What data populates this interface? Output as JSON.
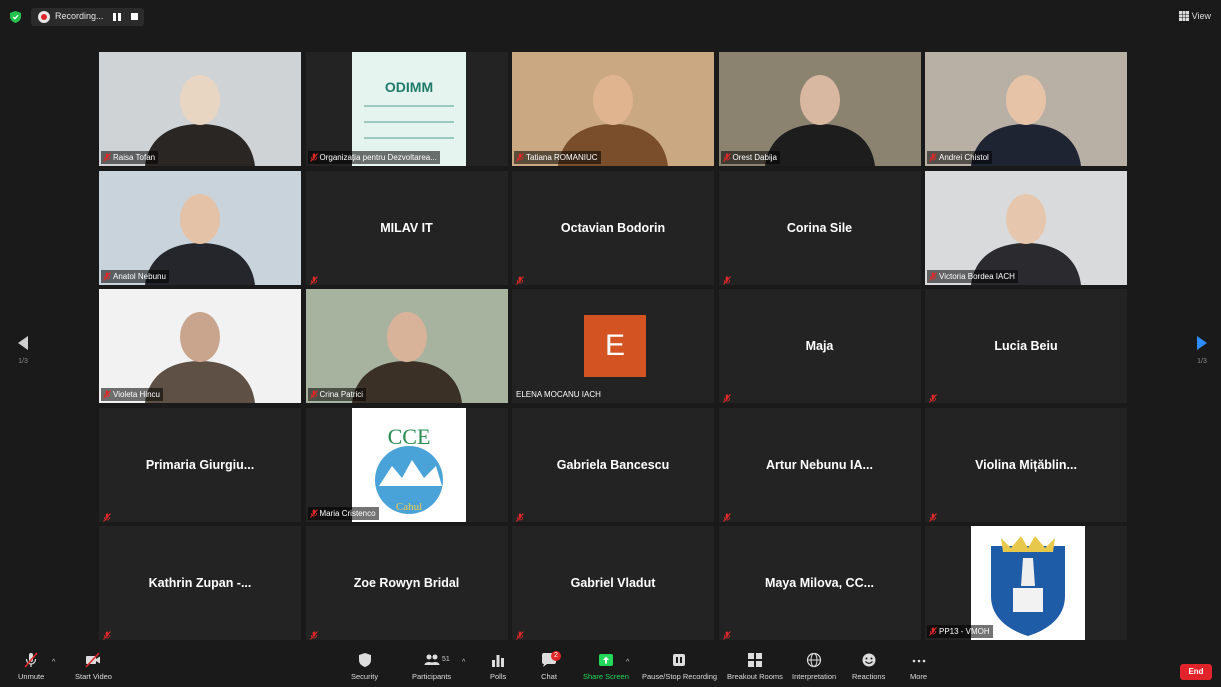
{
  "topbar": {
    "recording_label": "Recording...",
    "view_label": "View"
  },
  "pager": {
    "left_page": "1/3",
    "right_page": "1/3"
  },
  "participants": [
    {
      "name": "Raisa Tofan",
      "type": "video"
    },
    {
      "name": "Organizația pentru Dezvoltarea...",
      "type": "logo"
    },
    {
      "name": "Tatiana ROMANIUC",
      "type": "video"
    },
    {
      "name": "Orest Dabija",
      "type": "video"
    },
    {
      "name": "Andrei Chistol",
      "type": "video",
      "active": true
    },
    {
      "name": "Anatol Nebunu",
      "type": "video"
    },
    {
      "name": "MILAV IT",
      "type": "name"
    },
    {
      "name": "Octavian Bodorin",
      "type": "name"
    },
    {
      "name": "Corina Sile",
      "type": "name"
    },
    {
      "name": "Victoria Bordea IACH",
      "type": "video"
    },
    {
      "name": "Violeta Hincu",
      "type": "video"
    },
    {
      "name": "Crina Patrici",
      "type": "video"
    },
    {
      "name": "ELENA MOCANU IACH",
      "type": "avatar",
      "initial": "E"
    },
    {
      "name": "Maja",
      "type": "name"
    },
    {
      "name": "Lucia Beiu",
      "type": "name"
    },
    {
      "name": "Primaria Giurgiu...",
      "type": "name"
    },
    {
      "name": "Maria Cristenco",
      "type": "logo"
    },
    {
      "name": "Gabriela Bancescu",
      "type": "name"
    },
    {
      "name": "Artur Nebunu IA...",
      "type": "name"
    },
    {
      "name": "Violina Mițăblin...",
      "type": "name"
    },
    {
      "name": "Kathrin Zupan -...",
      "type": "name"
    },
    {
      "name": "Zoe Rowyn Bridal",
      "type": "name"
    },
    {
      "name": "Gabriel Vladut",
      "type": "name"
    },
    {
      "name": "Maya Milova, CC...",
      "type": "name"
    },
    {
      "name": "PP13 - VMOH",
      "type": "logo"
    }
  ],
  "logos": {
    "odimm_text": "ODIMM",
    "cce_text": "CCE",
    "cce_sub": "Cahul"
  },
  "toolbar": {
    "unmute": "Unmute",
    "start_video": "Start Video",
    "security": "Security",
    "participants": "Participants",
    "participants_count": "51",
    "polls": "Polls",
    "chat": "Chat",
    "chat_badge": "2",
    "share_screen": "Share Screen",
    "pause_stop_recording": "Pause/Stop Recording",
    "breakout_rooms": "Breakout Rooms",
    "interpretation": "Interpretation",
    "reactions": "Reactions",
    "more": "More",
    "end": "End"
  },
  "colors": {
    "background": "#1a1a1a",
    "tile": "#232323",
    "active_speaker": "#b7d96b",
    "share_green": "#23d959",
    "end_red": "#e0242a",
    "avatar_orange": "#d35422"
  }
}
